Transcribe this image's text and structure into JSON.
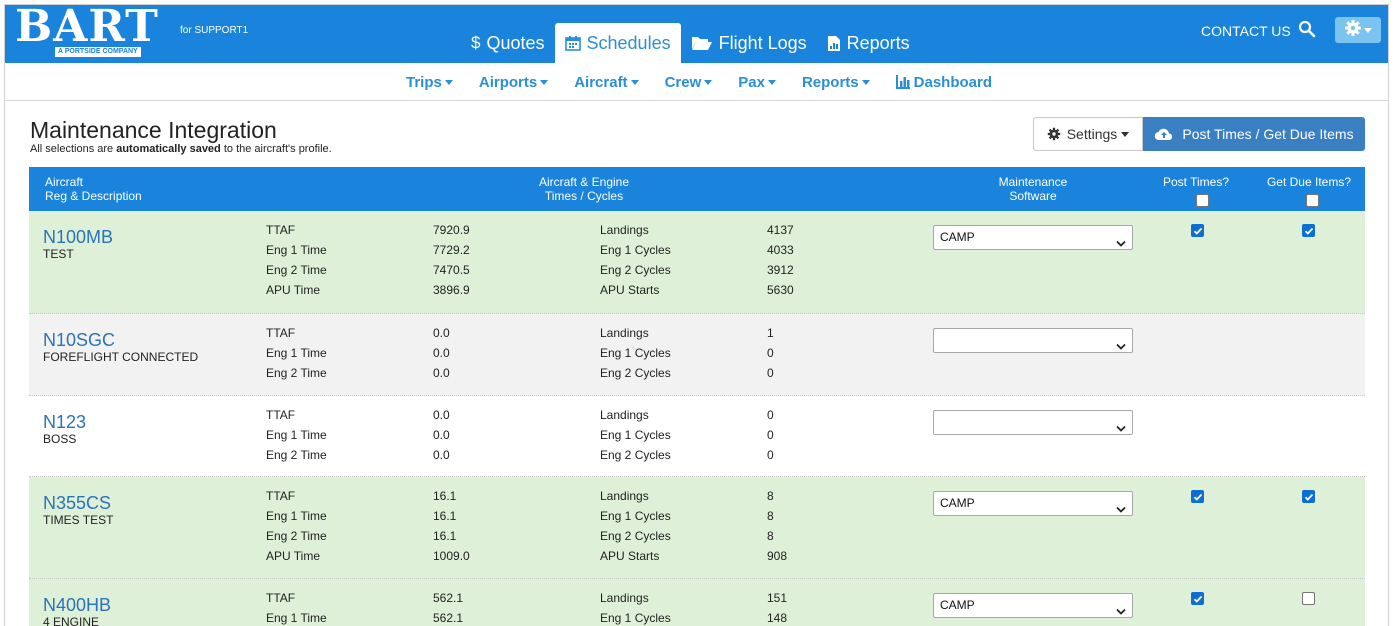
{
  "brand": {
    "logo_text": "BART",
    "logo_sub": "A PORTSIDE COMPANY",
    "for_user": "for SUPPORT1"
  },
  "main_tabs": [
    {
      "label": "Quotes",
      "icon": "dollar-icon",
      "active": false
    },
    {
      "label": "Schedules",
      "icon": "calendar-icon",
      "active": true
    },
    {
      "label": "Flight Logs",
      "icon": "folder-open-icon",
      "active": false
    },
    {
      "label": "Reports",
      "icon": "file-chart-icon",
      "active": false
    }
  ],
  "header_right": {
    "contact": "CONTACT US"
  },
  "subnav": [
    {
      "label": "Trips"
    },
    {
      "label": "Airports"
    },
    {
      "label": "Aircraft"
    },
    {
      "label": "Crew"
    },
    {
      "label": "Pax"
    },
    {
      "label": "Reports"
    },
    {
      "label": "Dashboard"
    }
  ],
  "page": {
    "title": "Maintenance Integration",
    "subtitle_pre": "All selections are ",
    "subtitle_bold": "automatically saved",
    "subtitle_post": " to the aircraft's profile.",
    "settings_label": "Settings",
    "post_label": "Post Times / Get Due Items"
  },
  "table": {
    "headers": {
      "aircraft_1": "Aircraft",
      "aircraft_2": "Reg & Description",
      "times_1": "Aircraft & Engine",
      "times_2": "Times / Cycles",
      "maint_1": "Maintenance",
      "maint_2": "Software",
      "post": "Post Times?",
      "due": "Get Due Items?"
    },
    "rows": [
      {
        "reg": "N100MB",
        "desc": "TEST",
        "software": "CAMP",
        "post": true,
        "due": true,
        "times": [
          {
            "label": "TTAF",
            "value": "7920.9",
            "clabel": "Landings",
            "cvalue": "4137"
          },
          {
            "label": "Eng 1 Time",
            "value": "7729.2",
            "clabel": "Eng 1 Cycles",
            "cvalue": "4033"
          },
          {
            "label": "Eng 2 Time",
            "value": "7470.5",
            "clabel": "Eng 2 Cycles",
            "cvalue": "3912"
          },
          {
            "label": "APU Time",
            "value": "3896.9",
            "clabel": "APU Starts",
            "cvalue": "5630"
          }
        ]
      },
      {
        "reg": "N10SGC",
        "desc": "FOREFLIGHT CONNECTED",
        "software": "",
        "post": null,
        "due": null,
        "times": [
          {
            "label": "TTAF",
            "value": "0.0",
            "clabel": "Landings",
            "cvalue": "1"
          },
          {
            "label": "Eng 1 Time",
            "value": "0.0",
            "clabel": "Eng 1 Cycles",
            "cvalue": "0"
          },
          {
            "label": "Eng 2 Time",
            "value": "0.0",
            "clabel": "Eng 2 Cycles",
            "cvalue": "0"
          }
        ]
      },
      {
        "reg": "N123",
        "desc": "BOSS",
        "software": "",
        "post": null,
        "due": null,
        "times": [
          {
            "label": "TTAF",
            "value": "0.0",
            "clabel": "Landings",
            "cvalue": "0"
          },
          {
            "label": "Eng 1 Time",
            "value": "0.0",
            "clabel": "Eng 1 Cycles",
            "cvalue": "0"
          },
          {
            "label": "Eng 2 Time",
            "value": "0.0",
            "clabel": "Eng 2 Cycles",
            "cvalue": "0"
          }
        ]
      },
      {
        "reg": "N355CS",
        "desc": "TIMES TEST",
        "software": "CAMP",
        "post": true,
        "due": true,
        "times": [
          {
            "label": "TTAF",
            "value": "16.1",
            "clabel": "Landings",
            "cvalue": "8"
          },
          {
            "label": "Eng 1 Time",
            "value": "16.1",
            "clabel": "Eng 1 Cycles",
            "cvalue": "8"
          },
          {
            "label": "Eng 2 Time",
            "value": "16.1",
            "clabel": "Eng 2 Cycles",
            "cvalue": "8"
          },
          {
            "label": "APU Time",
            "value": "1009.0",
            "clabel": "APU Starts",
            "cvalue": "908"
          }
        ]
      },
      {
        "reg": "N400HB",
        "desc": "4 ENGINE",
        "software": "CAMP",
        "post": true,
        "due": false,
        "times": [
          {
            "label": "TTAF",
            "value": "562.1",
            "clabel": "Landings",
            "cvalue": "151"
          },
          {
            "label": "Eng 1 Time",
            "value": "562.1",
            "clabel": "Eng 1 Cycles",
            "cvalue": "148"
          }
        ]
      }
    ]
  }
}
